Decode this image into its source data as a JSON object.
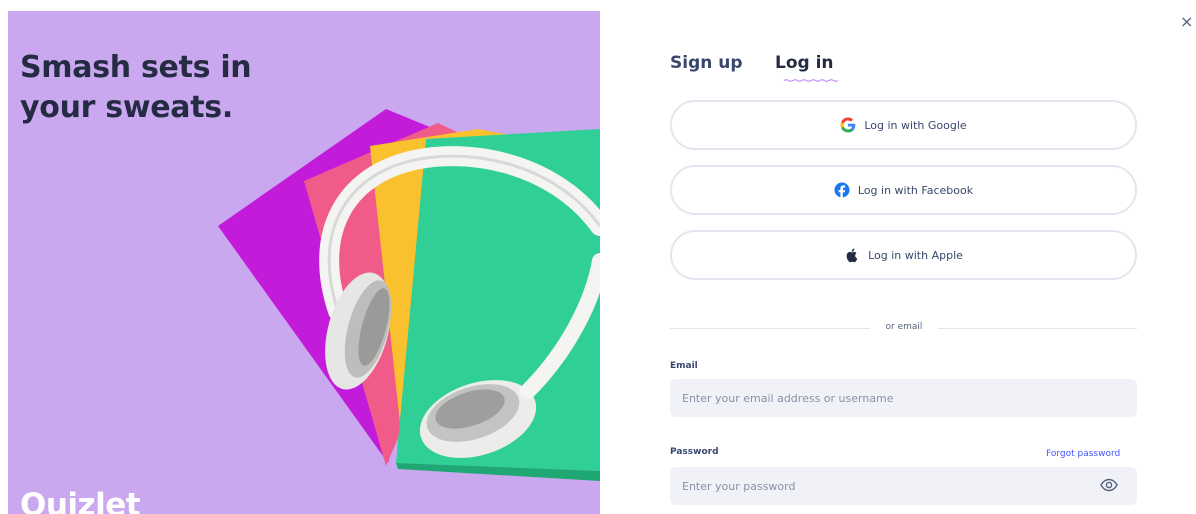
{
  "hero": {
    "headline": "Smash sets in your sweats.",
    "brand": "Quizlet",
    "background_color": "#c9a8f0"
  },
  "close_label": "×",
  "tabs": [
    {
      "label": "Sign up",
      "active": false
    },
    {
      "label": "Log in",
      "active": true
    }
  ],
  "social": {
    "google": {
      "label": "Log in with Google",
      "icon": "google-icon"
    },
    "facebook": {
      "label": "Log in with Facebook",
      "icon": "facebook-icon"
    },
    "apple": {
      "label": "Log in with Apple",
      "icon": "apple-icon"
    }
  },
  "divider_text": "or email",
  "email": {
    "label": "Email",
    "placeholder": "Enter your email address or username",
    "value": ""
  },
  "password": {
    "label": "Password",
    "placeholder": "Enter your password",
    "value": "",
    "forgot_label": "Forgot password",
    "toggle_icon": "eye-icon"
  },
  "colors": {
    "accent": "#4255ff",
    "text_dark": "#262b44",
    "tab_underline": "#c68dfc",
    "input_bg": "#f1f2f7"
  }
}
